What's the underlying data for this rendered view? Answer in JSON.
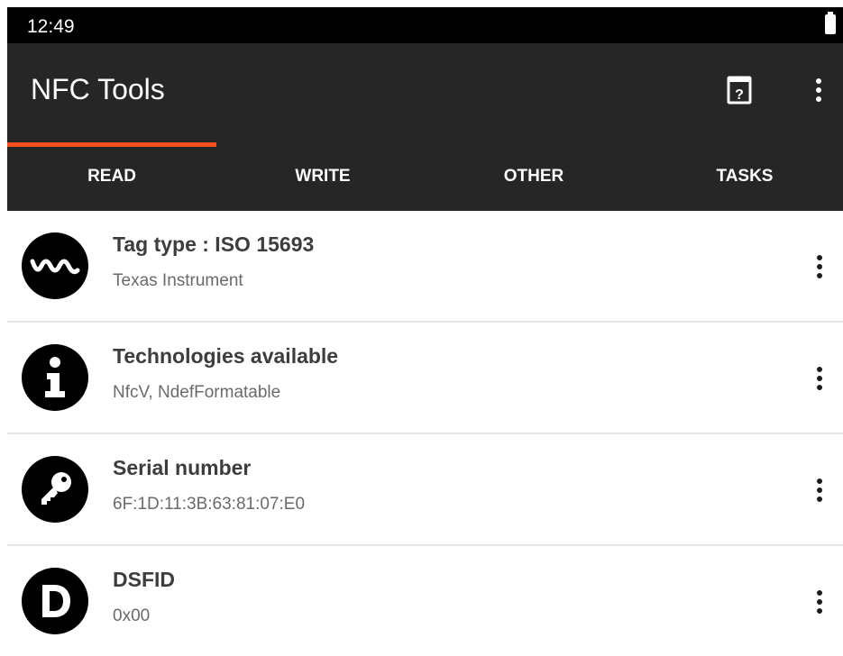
{
  "status_bar": {
    "time": "12:49"
  },
  "app_bar": {
    "title": "NFC Tools"
  },
  "tabs": [
    {
      "label": "READ",
      "selected": true
    },
    {
      "label": "WRITE",
      "selected": false
    },
    {
      "label": "OTHER",
      "selected": false
    },
    {
      "label": "TASKS",
      "selected": false
    }
  ],
  "rows": [
    {
      "title": "Tag type : ISO 15693",
      "subtitle": "Texas Instrument",
      "icon": "waveform-icon"
    },
    {
      "title": "Technologies available",
      "subtitle": "NfcV, NdefFormatable",
      "icon": "info-icon"
    },
    {
      "title": "Serial number",
      "subtitle": "6F:1D:11:3B:63:81:07:E0",
      "icon": "key-icon"
    },
    {
      "title": "DSFID",
      "subtitle": "0x00",
      "icon": "letter-d-icon"
    }
  ],
  "colors": {
    "app_bar": "#262626",
    "status_bar": "#000000",
    "tab_indicator": "#f4511e"
  }
}
